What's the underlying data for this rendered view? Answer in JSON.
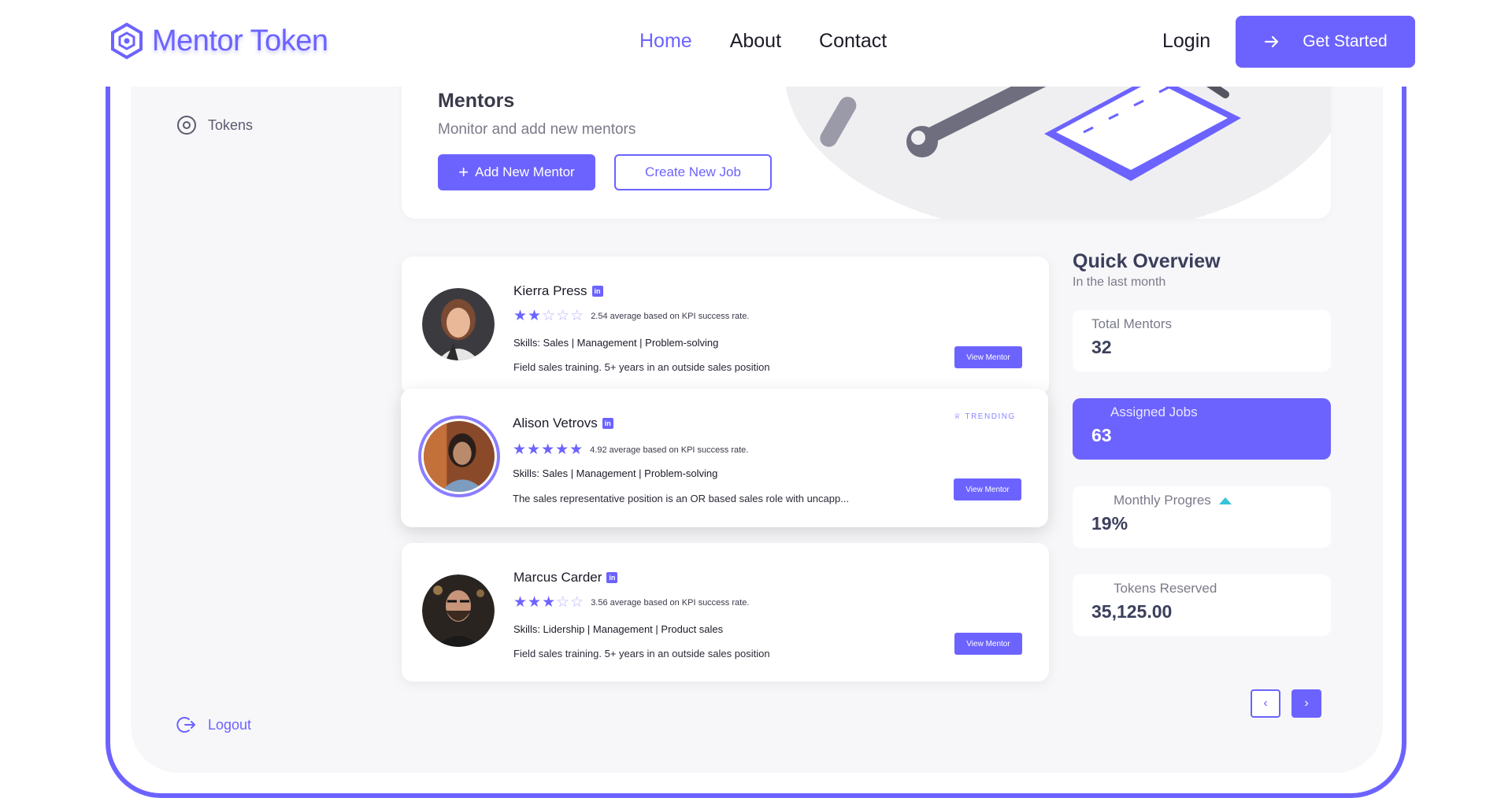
{
  "brand": {
    "name": "Mentor Token",
    "accent": "#6c63ff"
  },
  "nav": {
    "links": [
      {
        "label": "Home",
        "active": true
      },
      {
        "label": "About",
        "active": false
      },
      {
        "label": "Contact",
        "active": false
      }
    ],
    "login_label": "Login",
    "cta_label": "Get Started"
  },
  "sidebar": {
    "items": [
      {
        "label": "Tokens",
        "icon": "target-icon"
      }
    ],
    "logout_label": "Logout"
  },
  "header_card": {
    "title": "Mentors",
    "subtitle": "Monitor and add new mentors",
    "add_button": "Add New Mentor",
    "job_button": "Create New Job"
  },
  "mentors": [
    {
      "name": "Kierra Press",
      "rating": 2.54,
      "stars_filled": 2,
      "rating_text": "2.54 average based on KPI success rate.",
      "skills": "Skills: Sales | Management | Problem-solving",
      "description": "Field sales training. 5+ years in an outside sales position",
      "view_label": "View Mentor"
    },
    {
      "name": "Alison Vetrovs",
      "rating": 4.92,
      "stars_filled": 5,
      "badge": "TRENDING",
      "rating_text": "4.92 average based on KPI success rate.",
      "skills": "Skills: Sales | Management | Problem-solving",
      "description": "The sales representative position is an OR based sales role with uncapp...",
      "view_label": "View Mentor"
    },
    {
      "name": "Marcus Carder",
      "rating": 3.56,
      "stars_filled": 3,
      "rating_text": "3.56 average based on KPI success rate.",
      "skills": "Skills: Lidership | Management | Product sales",
      "description": "Field sales training. 5+ years in an outside sales position",
      "view_label": "View Mentor"
    }
  ],
  "overview": {
    "title": "Quick Overview",
    "subtitle": "In the last month",
    "stats": [
      {
        "label": "Total Mentors",
        "value": "32"
      },
      {
        "label": "Assigned Jobs",
        "value": "63"
      },
      {
        "label": "Monthly Progres",
        "value": "19%"
      },
      {
        "label": "Tokens Reserved",
        "value": "35,125.00"
      }
    ]
  },
  "pager": {
    "prev": "‹",
    "next": "›"
  }
}
